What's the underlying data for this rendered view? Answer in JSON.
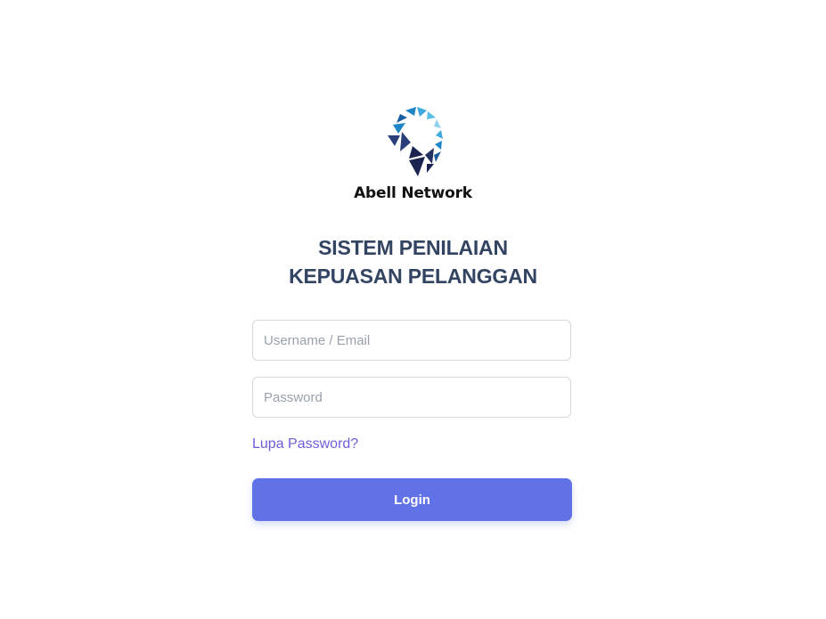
{
  "brand": {
    "name": "Abell Network",
    "logo_icon": "abell-network-logo",
    "logo_colors": [
      "#1f86c6",
      "#3fa9dd",
      "#8fd0ee",
      "#1d5fa3",
      "#2a3f7a",
      "#1b2350"
    ]
  },
  "title": {
    "line1": "SISTEM PENILAIAN",
    "line2": "KEPUASAN PELANGGAN"
  },
  "form": {
    "username_placeholder": "Username / Email",
    "username_value": "",
    "password_placeholder": "Password",
    "password_value": "",
    "forgot_label": "Lupa Password?",
    "login_label": "Login"
  },
  "colors": {
    "title": "#334463",
    "link": "#6a5fd8",
    "button": "#6172e6"
  }
}
